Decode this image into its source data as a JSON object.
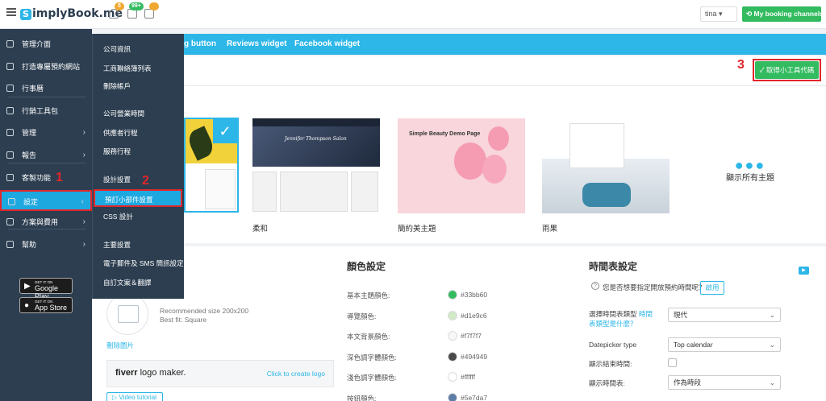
{
  "header": {
    "logo": "SimplyBook.me",
    "logo_letter": "S",
    "badges": {
      "notifications": "5",
      "tasks": "99+",
      "calendar": ""
    },
    "user": "tina",
    "channels_button": "My booking channels"
  },
  "sidebar": {
    "items": [
      {
        "label": "管理介面",
        "icon": "dashboard-icon"
      },
      {
        "label": "打造專屬預約網站",
        "icon": "lightbulb-icon"
      },
      {
        "label": "行事曆",
        "icon": "calendar-icon"
      },
      {
        "label": "行銷工具包",
        "icon": "megaphone-icon"
      },
      {
        "label": "管理",
        "icon": "pencil-icon",
        "arrow": "›"
      },
      {
        "label": "報告",
        "icon": "chart-icon",
        "arrow": "›"
      },
      {
        "label": "客製功能",
        "icon": "plugin-icon"
      },
      {
        "label": "設定",
        "icon": "gear-icon",
        "arrow": "‹"
      },
      {
        "label": "方案與費用",
        "icon": "billing-icon",
        "arrow": "›"
      },
      {
        "label": "幫助",
        "icon": "chat-icon",
        "arrow": "›"
      }
    ],
    "google_play": {
      "small": "GET IT ON",
      "big": "Google Play"
    },
    "app_store": {
      "small": "GET IT ON",
      "big": "App Store"
    }
  },
  "submenu": {
    "items": [
      "公司資訊",
      "工商聯絡簿列表",
      "刪除帳戶",
      "公司營業時間",
      "供應者行程",
      "服務行程",
      "設計設置",
      "預訂小部件設置",
      "CSS 設計",
      "主要設置",
      "電子郵件及 SMS 簡訊設定",
      "自訂文案＆翻譯"
    ]
  },
  "steps": {
    "one": "1",
    "two": "2",
    "three": "3"
  },
  "tabs": [
    "g button",
    "Reviews widget",
    "Facebook widget"
  ],
  "get_code_button": "✓ 取得小工具代碼",
  "themes": {
    "items": [
      {
        "label": "柔和",
        "preview_title": "Jennifer Thompson Salon"
      },
      {
        "label": "簡約美主題",
        "preview_title": "Simple Beauty Demo Page"
      },
      {
        "label": "雨果",
        "preview_title": ""
      }
    ],
    "show_all": "顯示所有主題"
  },
  "logo_upload": {
    "recommended": "Recommended size 200x200",
    "best_fit": "Best fit: Square",
    "delete": "刪除圖片",
    "fiverr_brand": "fiverr",
    "fiverr_suffix": " logo maker.",
    "fiverr_link": "Click to create logo",
    "video_tutorial": "Video tutorial"
  },
  "colors": {
    "title": "顏色設定",
    "items": [
      {
        "label": "基本主題顏色:",
        "hex": "#33bb60"
      },
      {
        "label": "導覽顏色:",
        "hex": "#d1e9c6"
      },
      {
        "label": "本文背景顏色:",
        "hex": "#f7f7f7"
      },
      {
        "label": "深色調字體顏色:",
        "hex": "#494949"
      },
      {
        "label": "淺色調字體顏色:",
        "hex": "#ffffff"
      },
      {
        "label": "按鈕顏色:",
        "hex": "#5e7da7"
      }
    ]
  },
  "schedule": {
    "title": "時間表設定",
    "question": "您是否想要指定開放預約時間呢？",
    "enable": "啟用",
    "type_label": "選擇時間表類型",
    "type_link": "時間表類型是什麼？",
    "type_value": "現代",
    "picker_label": "Datepicker type",
    "picker_value": "Top calendar",
    "show_end_label": "顯示結束時間:",
    "show_sched_label": "顯示時間表:",
    "show_sched_value": "作為時段"
  }
}
